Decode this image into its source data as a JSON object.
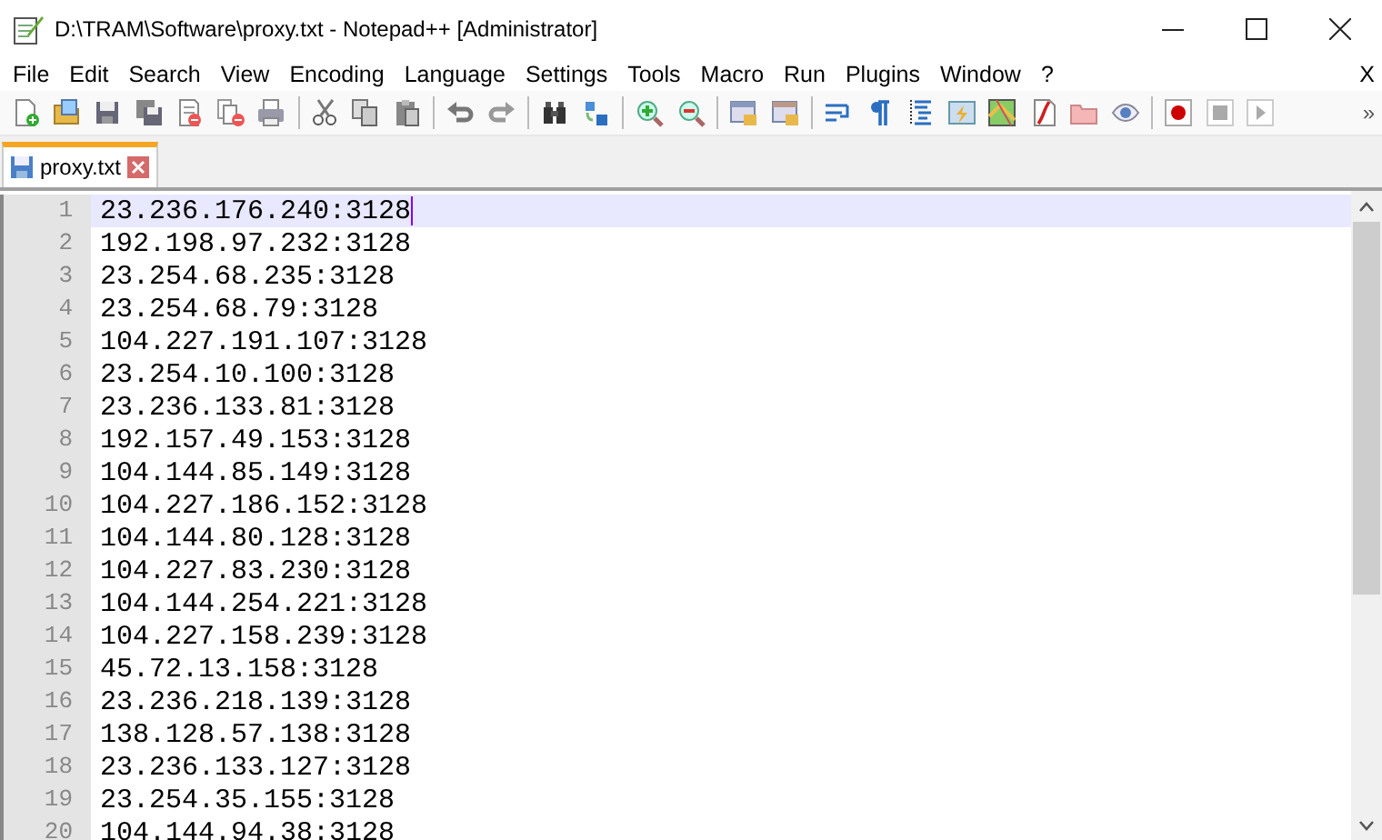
{
  "window": {
    "title": "D:\\TRAM\\Software\\proxy.txt - Notepad++ [Administrator]"
  },
  "menu": [
    "File",
    "Edit",
    "Search",
    "View",
    "Encoding",
    "Language",
    "Settings",
    "Tools",
    "Macro",
    "Run",
    "Plugins",
    "Window",
    "?"
  ],
  "menu_close": "X",
  "toolbar_overflow": "»",
  "tabs": [
    {
      "label": "proxy.txt",
      "selected": true
    }
  ],
  "editor": {
    "lines": [
      {
        "number": "1",
        "text": "23.236.176.240:3128",
        "current": true
      },
      {
        "number": "2",
        "text": "192.198.97.232:3128",
        "current": false
      },
      {
        "number": "3",
        "text": "23.254.68.235:3128",
        "current": false
      },
      {
        "number": "4",
        "text": "23.254.68.79:3128",
        "current": false
      },
      {
        "number": "5",
        "text": "104.227.191.107:3128",
        "current": false
      },
      {
        "number": "6",
        "text": "23.254.10.100:3128",
        "current": false
      },
      {
        "number": "7",
        "text": "23.236.133.81:3128",
        "current": false
      },
      {
        "number": "8",
        "text": "192.157.49.153:3128",
        "current": false
      },
      {
        "number": "9",
        "text": "104.144.85.149:3128",
        "current": false
      },
      {
        "number": "10",
        "text": "104.227.186.152:3128",
        "current": false
      },
      {
        "number": "11",
        "text": "104.144.80.128:3128",
        "current": false
      },
      {
        "number": "12",
        "text": "104.227.83.230:3128",
        "current": false
      },
      {
        "number": "13",
        "text": "104.144.254.221:3128",
        "current": false
      },
      {
        "number": "14",
        "text": "104.227.158.239:3128",
        "current": false
      },
      {
        "number": "15",
        "text": "45.72.13.158:3128",
        "current": false
      },
      {
        "number": "16",
        "text": "23.236.218.139:3128",
        "current": false
      },
      {
        "number": "17",
        "text": "138.128.57.138:3128",
        "current": false
      },
      {
        "number": "18",
        "text": "23.236.133.127:3128",
        "current": false
      },
      {
        "number": "19",
        "text": "23.254.35.155:3128",
        "current": false
      },
      {
        "number": "20",
        "text": "104.144.94.38:3128",
        "current": false
      }
    ]
  }
}
